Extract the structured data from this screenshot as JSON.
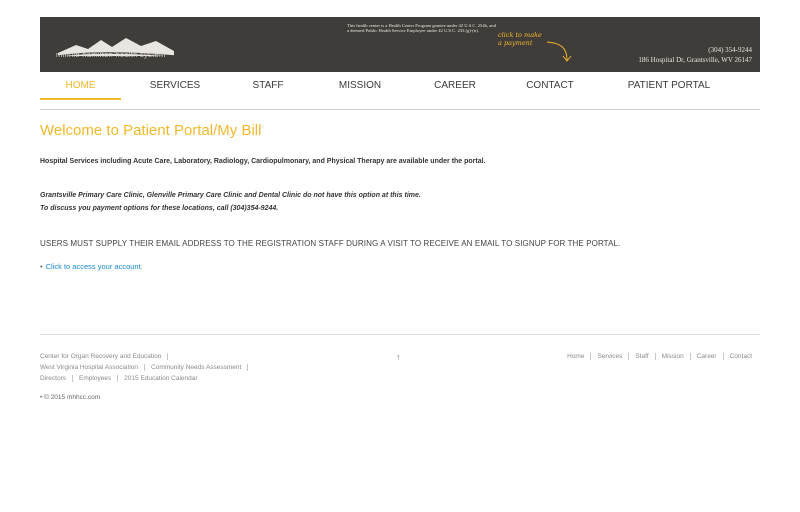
{
  "header": {
    "logo_text": "minnie hamilton health system",
    "grant_notice": "This health center is a Health Center Program grantee under 42 U.S.C. 254b, and a deemed Public Health Service Employee under 42 U.S.C. 233 (g)-(n).",
    "payment_prompt_line1": "click to make",
    "payment_prompt_line2": "a payment",
    "phone": "(304) 354-9244",
    "address": "186 Hospital Dr, Grantsville, WV 26147",
    "accent_color": "#f1b92c",
    "banner_color": "#403c39"
  },
  "nav": {
    "items": [
      {
        "label": "HOME",
        "active": true
      },
      {
        "label": "SERVICES"
      },
      {
        "label": "STAFF"
      },
      {
        "label": "MISSION"
      },
      {
        "label": "CAREER"
      },
      {
        "label": "CONTACT"
      },
      {
        "label": "PATIENT PORTAL"
      }
    ]
  },
  "main": {
    "title": "Welcome to Patient Portal/My Bill",
    "services_text": "Hospital Services including Acute Care, Laboratory, Radiology, Cardiopulmonary, and Physical Therapy are available under the portal.",
    "clinics_text_line1": "Grantsville Primary Care Clinic, Glenville Primary Care Clinic and Dental Clinic do not have this option at this time.",
    "clinics_text_line2": "To discuss you payment options for these locations, call (304)354-9244.",
    "email_notice": "USERS MUST SUPPLY THEIR EMAIL ADDRESS TO THE REGISTRATION STAFF DURING A VISIT TO RECEIVE AN EMAIL TO SIGNUP FOR THE PORTAL.",
    "account_link": "Click to access your account."
  },
  "footer": {
    "links_row1": [
      "Center for Organ Recovery and Education"
    ],
    "links_row2": [
      "West Virginia Hospital Association",
      "Community Needs Assessment"
    ],
    "links_row3": [
      "Directors",
      "Employees",
      "2015 Education Calendar"
    ],
    "back_to_top": "↑",
    "nav": [
      "Home",
      "Services",
      "Staff",
      "Mission",
      "Career",
      "Contact"
    ],
    "copyright": "© 2015 mhhcc.com"
  }
}
